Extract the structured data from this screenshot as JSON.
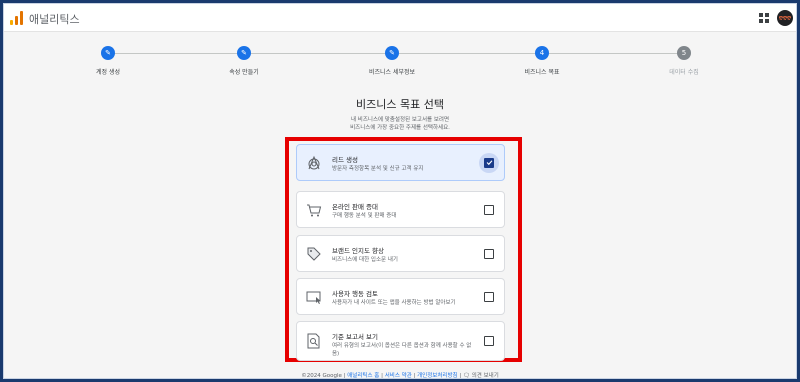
{
  "app": {
    "title": "애널리틱스",
    "avatar_text": "ღღღ"
  },
  "stepper": {
    "steps": [
      {
        "label": "계정 생성",
        "status": "done"
      },
      {
        "label": "속성 만들기",
        "status": "done"
      },
      {
        "label": "비즈니스 세부정보",
        "status": "done"
      },
      {
        "label": "비즈니스 목표",
        "status": "current",
        "number": "4"
      },
      {
        "label": "데이터 수집",
        "status": "todo",
        "number": "5"
      }
    ]
  },
  "main": {
    "title": "비즈니스 목표 선택",
    "subtitle_line1": "내 비즈니스에 맞춤설정된 보고서를 보려면",
    "subtitle_line2": "비즈니스에 가장 중요한 주제를 선택하세요."
  },
  "options": [
    {
      "title": "리드 생성",
      "desc": "방문자 측정항목 분석 및 신규 고객 유지",
      "checked": true,
      "icon": "target-icon"
    },
    {
      "title": "온라인 판매 증대",
      "desc": "구매 행동 분석 및 판매 증대",
      "checked": false,
      "icon": "shopping-cart-icon"
    },
    {
      "title": "브랜드 인지도 향상",
      "desc": "비즈니스에 대한 입소문 내기",
      "checked": false,
      "icon": "tag-icon"
    },
    {
      "title": "사용자 행동 검토",
      "desc": "사용자가 내 사이트 또는 앱을 사용하는 방법 알아보기",
      "checked": false,
      "icon": "monitor-cursor-icon"
    },
    {
      "title": "기준 보고서 보기",
      "desc": "여러 유형의 보고서(이 옵션은 다른 옵션과 함께 사용할 수 없음)",
      "checked": false,
      "icon": "report-search-icon"
    }
  ],
  "footer": {
    "copyright": "©2024 Google",
    "link_home": "애널리틱스 홈",
    "link_terms": "서비스 약관",
    "link_privacy": "개인정보처리방침",
    "feedback": "의견 보내기"
  },
  "colors": {
    "accent": "#1a73e8",
    "highlight_border": "#e60000",
    "selected_bg": "#e8f0fe"
  }
}
